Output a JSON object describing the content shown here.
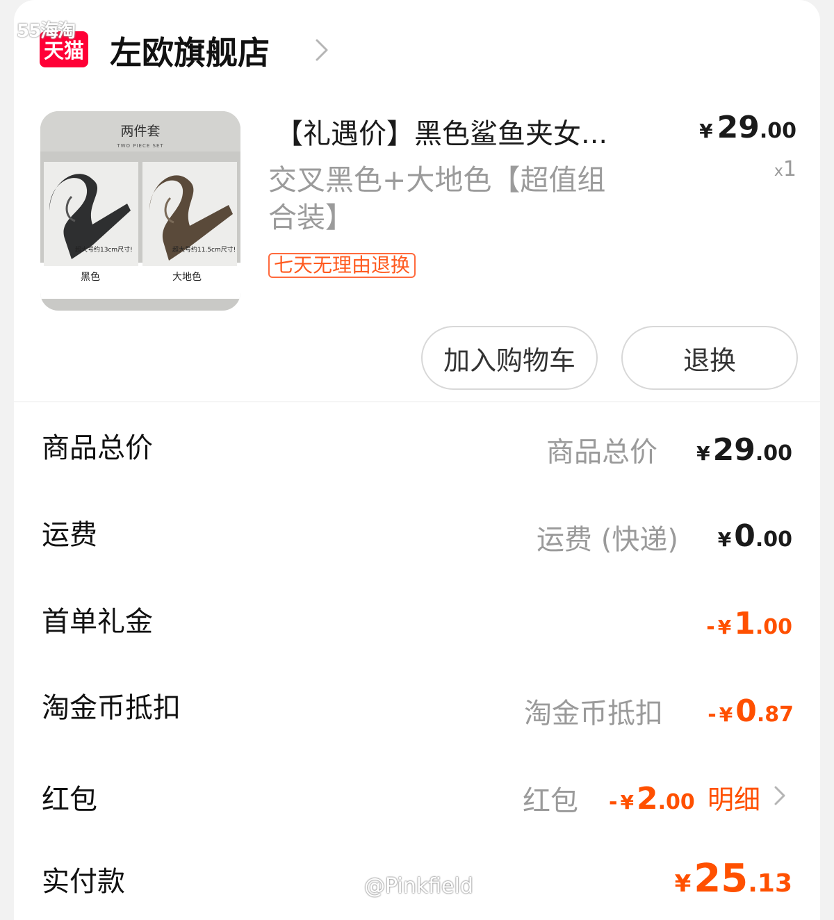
{
  "watermark_top": "55海淘",
  "store": {
    "platform_logo": "天猫",
    "name": "左欧旗舰店"
  },
  "product": {
    "image": {
      "title": "两件套",
      "subtitle": "TWO PIECE SET",
      "left_caption": "超大号约13cm尺寸!",
      "right_caption": "超大号约11.5cm尺寸!",
      "left_label": "黑色",
      "right_label": "大地色"
    },
    "title": "【礼遇价】黑色鲨鱼夹女...",
    "price_yen": "¥",
    "price_int": "29",
    "price_dec": ".00",
    "qty_x": "x",
    "qty": "1",
    "spec": "交叉黑色+大地色【超值组合装】",
    "badge": "七天无理由退换"
  },
  "actions": {
    "add_to_cart": "加入购物车",
    "return_exchange": "退换"
  },
  "summary": {
    "goods_total": {
      "label": "商品总价",
      "sub": "商品总价",
      "yen": "¥",
      "int": "29",
      "dec": ".00"
    },
    "shipping": {
      "label": "运费",
      "sub": "运费 (快递)",
      "yen": "¥",
      "int": "0",
      "dec": ".00"
    },
    "first_order": {
      "label": "首单礼金",
      "neg": "-",
      "yen": "¥",
      "int": "1",
      "dec": ".00"
    },
    "coins": {
      "label": "淘金币抵扣",
      "sub": "淘金币抵扣",
      "neg": "-",
      "yen": "¥",
      "int": "0",
      "dec": ".87"
    },
    "red_packet": {
      "label": "红包",
      "sub": "红包",
      "neg": "-",
      "yen": "¥",
      "int": "2",
      "dec": ".00",
      "detail": "明细"
    },
    "paid": {
      "label": "实付款",
      "yen": "¥",
      "int": "25",
      "dec": ".13"
    }
  },
  "watermark_bottom": "@Pinkfield",
  "colors": {
    "accent": "#ff5000",
    "tmall_red": "#ff0036"
  }
}
